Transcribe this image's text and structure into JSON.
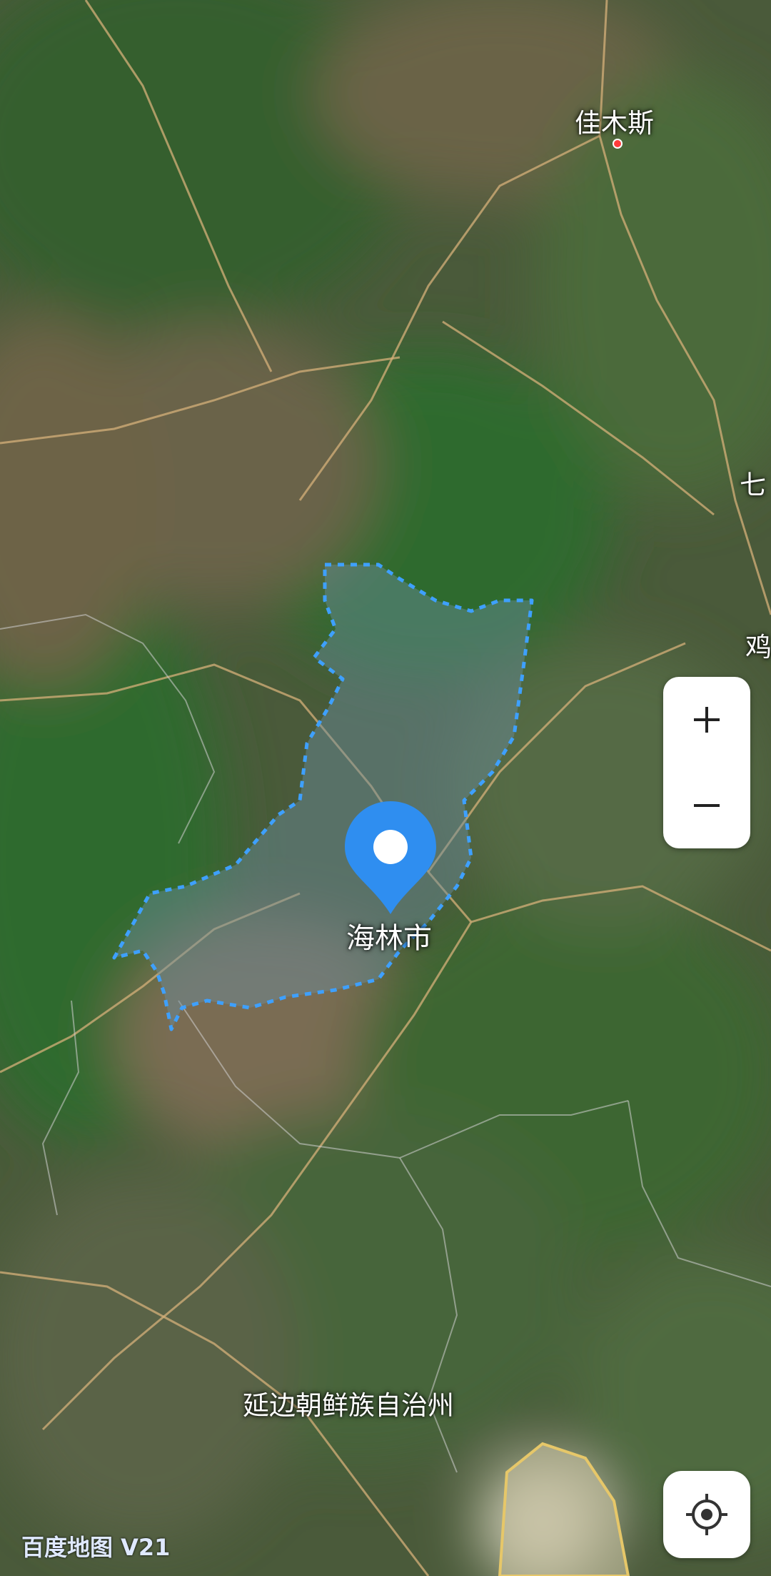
{
  "map": {
    "places": {
      "jiamusi": "佳木斯",
      "qitaihe_partial": "七",
      "jixi_partial": "鸡",
      "hailin": "海林市",
      "yanbian": "延边朝鲜族自治州"
    },
    "selected_city": "海林市",
    "controls": {
      "zoom_in": "+",
      "zoom_out": "−",
      "locate_icon": "locate-icon"
    },
    "watermark": "百度地图 V21"
  },
  "colors": {
    "region_border": "#3ea0ff",
    "pin": "#2f8ef0",
    "road": "#d6b07a",
    "boundary": "#cfcfcf"
  }
}
